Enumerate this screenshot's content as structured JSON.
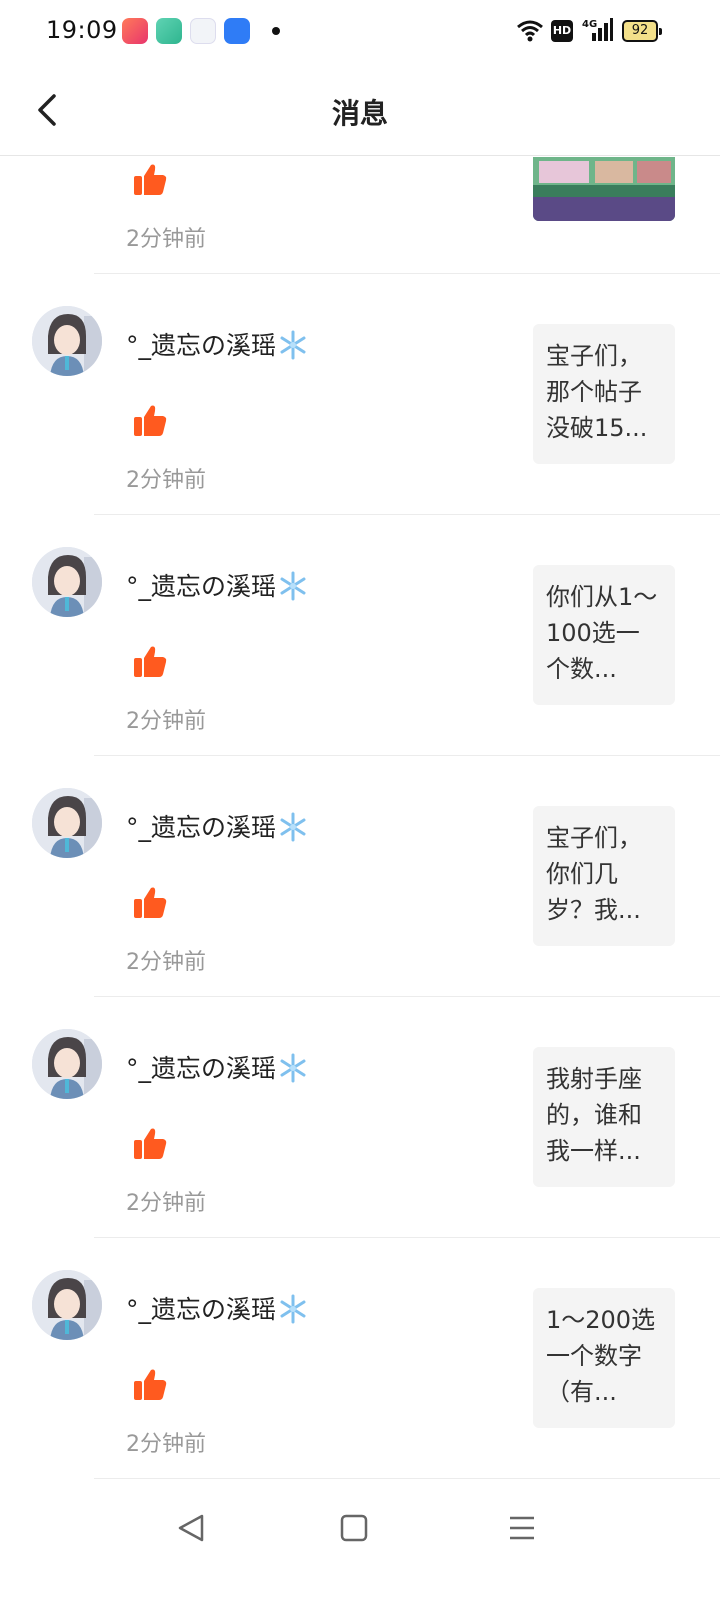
{
  "status_bar": {
    "time": "19:09",
    "network": "4G",
    "hd": "HD",
    "battery": "92"
  },
  "header": {
    "title": "消息"
  },
  "accent_color": "#ff5a1f",
  "messages": [
    {
      "time": "2分钟前"
    },
    {
      "username": "°_遗忘の溪瑶",
      "time": "2分钟前",
      "preview": "宝子们，那个帖子没破15..."
    },
    {
      "username": "°_遗忘の溪瑶",
      "time": "2分钟前",
      "preview": "你们从1～100选一个数..."
    },
    {
      "username": "°_遗忘の溪瑶",
      "time": "2分钟前",
      "preview": "宝子们，你们几岁？我..."
    },
    {
      "username": "°_遗忘の溪瑶",
      "time": "2分钟前",
      "preview": "我射手座的，谁和我一样..."
    },
    {
      "username": "°_遗忘の溪瑶",
      "time": "2分钟前",
      "preview": "1～200选一个数字（有..."
    }
  ]
}
